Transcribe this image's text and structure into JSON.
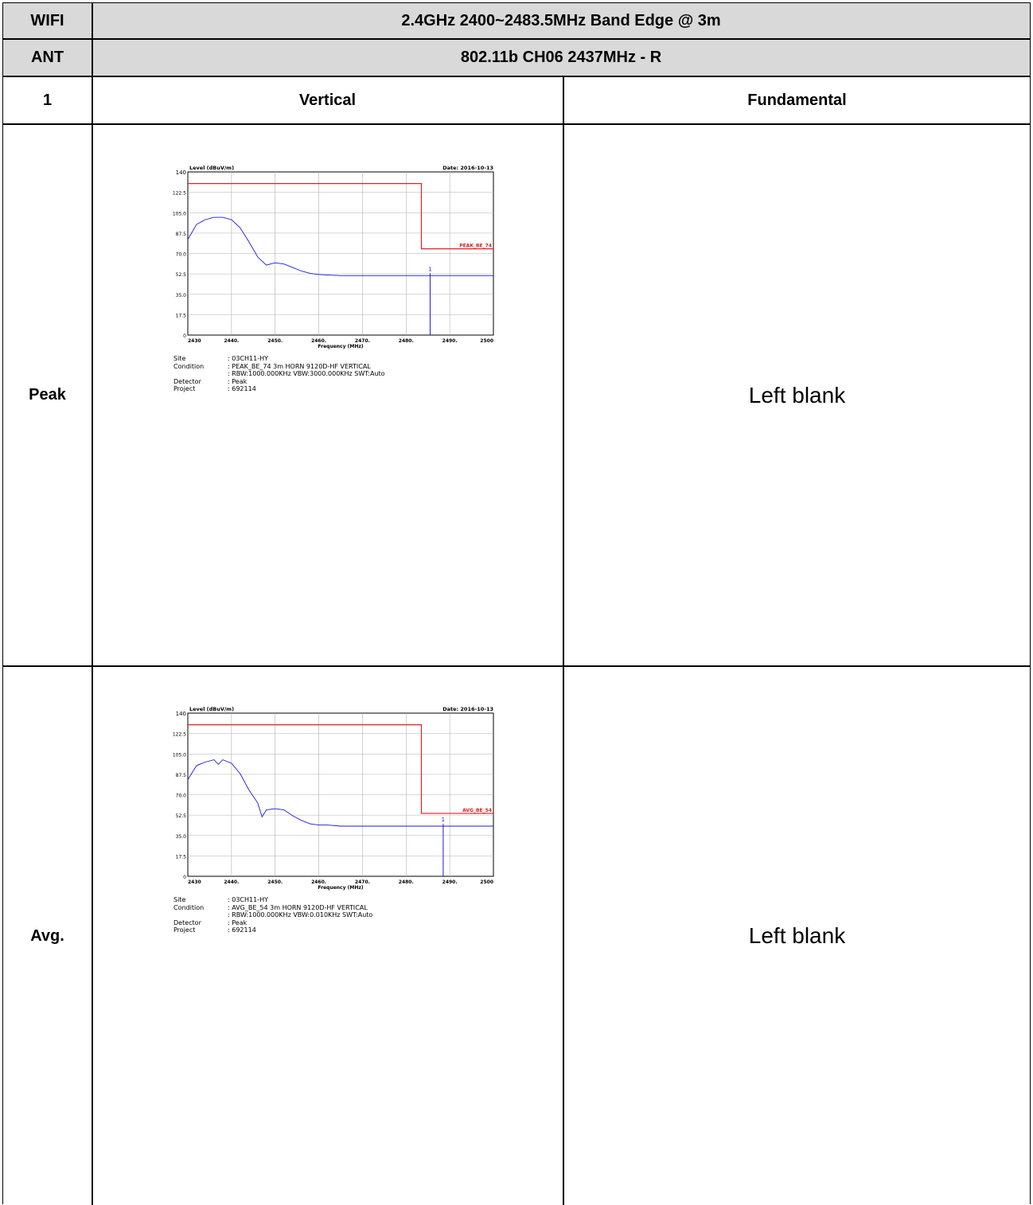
{
  "header": {
    "row1_label": "WIFI",
    "row1_title": "2.4GHz 2400~2483.5MHz Band Edge @ 3m",
    "row2_label": "ANT",
    "row2_title": "802.11b CH06 2437MHz - R",
    "row3_label": "1",
    "col_vertical": "Vertical",
    "col_fundamental": "Fundamental"
  },
  "rows": [
    {
      "label": "Peak",
      "fundamental_text": "Left blank"
    },
    {
      "label": "Avg.",
      "fundamental_text": "Left blank"
    }
  ],
  "colors": {
    "header_bg": "#d9d9d9",
    "limit_line": "#e02020",
    "trace": "#1a1adb",
    "grid": "#b0b0b0"
  },
  "chart_data": [
    {
      "type": "line",
      "ylabel": "Level (dBuV/m)",
      "xlabel": "Frequency (MHz)",
      "date": "Date: 2016-10-13",
      "ylim": [
        0,
        140
      ],
      "xlim": [
        2430,
        2500
      ],
      "yticks": [
        "140",
        "122.5",
        "105.0",
        "87.5",
        "70.0",
        "52.5",
        "35.0",
        "17.5",
        "0"
      ],
      "xticks": [
        "2430",
        "2440.",
        "2450.",
        "2460.",
        "2470.",
        "2480.",
        "2490.",
        "2500"
      ],
      "limit_label": "PEAK_BE_74",
      "limit": {
        "x": [
          2430,
          2483.5,
          2483.5,
          2500
        ],
        "y": [
          130,
          130,
          74,
          74
        ]
      },
      "series": [
        {
          "x": [
            2430,
            2432,
            2434,
            2436,
            2438,
            2440,
            2442,
            2444,
            2446,
            2448,
            2450,
            2452,
            2454,
            2456,
            2458,
            2460,
            2465,
            2470,
            2475,
            2480,
            2485,
            2490,
            2495,
            2500
          ],
          "y": [
            82,
            95,
            99,
            101,
            101,
            99,
            92,
            80,
            67,
            60,
            62,
            61,
            58,
            55,
            53,
            52,
            51,
            51,
            51,
            51,
            51,
            51,
            51,
            51
          ]
        }
      ],
      "marker": {
        "label": "1",
        "x": 2485.5,
        "y": 53
      },
      "site": ": 03CH11-HY",
      "condition": ": PEAK_BE_74 3m HORN 9120D-HF VERTICAL",
      "condition2": ": RBW:1000.000KHz VBW:3000.000KHz SWT:Auto",
      "detector": ": Peak",
      "project": ": 692114",
      "meta_labels": {
        "site": "Site",
        "condition": "Condition",
        "detector": "Detector",
        "project": "Project"
      }
    },
    {
      "type": "line",
      "ylabel": "Level (dBuV/m)",
      "xlabel": "Frequency (MHz)",
      "date": "Date: 2016-10-13",
      "ylim": [
        0,
        140
      ],
      "xlim": [
        2430,
        2500
      ],
      "yticks": [
        "140",
        "122.5",
        "105.0",
        "87.5",
        "70.0",
        "52.5",
        "35.0",
        "17.5",
        "0"
      ],
      "xticks": [
        "2430",
        "2440.",
        "2450.",
        "2460.",
        "2470.",
        "2480.",
        "2490.",
        "2500"
      ],
      "limit_label": "AVG_BE_54",
      "limit": {
        "x": [
          2430,
          2483.5,
          2483.5,
          2500
        ],
        "y": [
          130,
          130,
          54,
          54
        ]
      },
      "series": [
        {
          "x": [
            2430,
            2432,
            2434,
            2436,
            2437,
            2438,
            2440,
            2442,
            2444,
            2446,
            2447,
            2448,
            2450,
            2452,
            2454,
            2456,
            2458,
            2460,
            2462,
            2465,
            2470,
            2480,
            2490,
            2500
          ],
          "y": [
            83,
            95,
            98,
            100,
            96,
            100,
            97,
            88,
            74,
            63,
            51,
            57,
            58,
            57,
            52,
            48,
            45,
            44,
            44,
            43,
            43,
            43,
            43,
            43
          ]
        }
      ],
      "marker": {
        "label": "1",
        "x": 2488.5,
        "y": 45
      },
      "site": ": 03CH11-HY",
      "condition": ": AVG_BE_54 3m HORN 9120D-HF VERTICAL",
      "condition2": ": RBW:1000.000KHz VBW:0.010KHz SWT:Auto",
      "detector": ": Peak",
      "project": ": 692114",
      "meta_labels": {
        "site": "Site",
        "condition": "Condition",
        "detector": "Detector",
        "project": "Project"
      }
    }
  ]
}
